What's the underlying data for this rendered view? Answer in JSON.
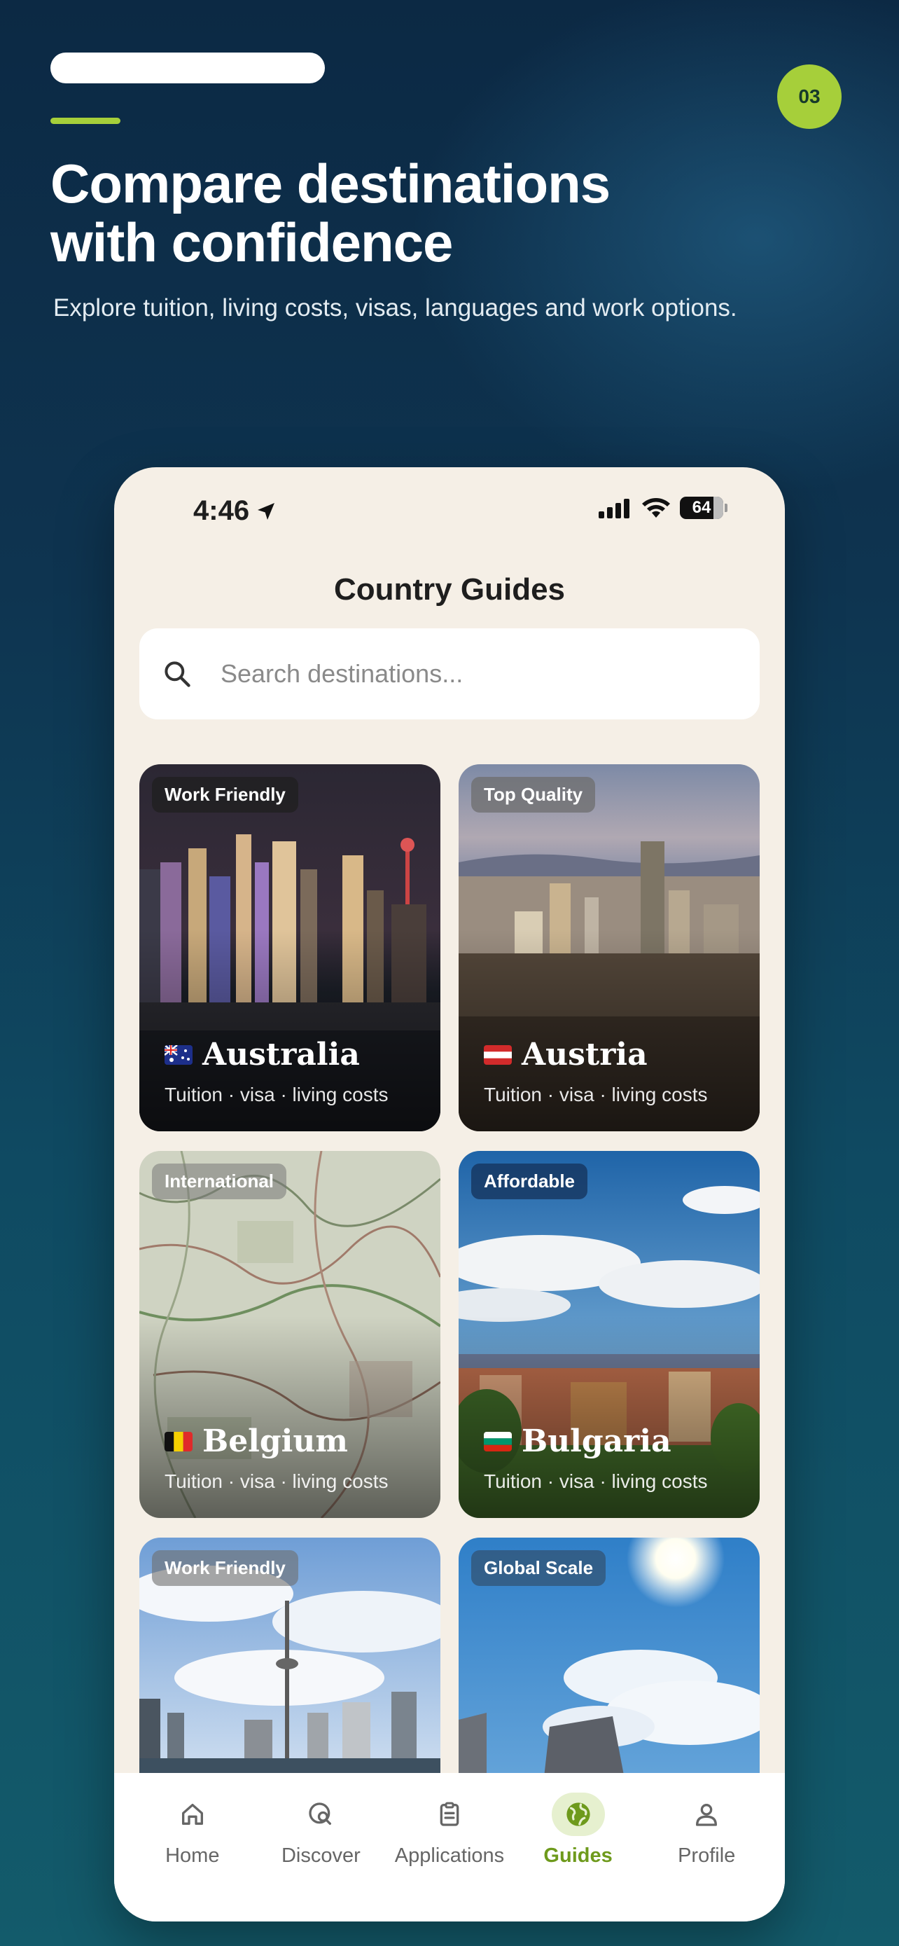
{
  "slide": {
    "step": "03",
    "headline_line1": "Compare destinations",
    "headline_line2": "with confidence",
    "subtitle": "Explore tuition, living costs, visas, languages and work options."
  },
  "status_bar": {
    "time": "4:46",
    "battery": "64"
  },
  "screen": {
    "title": "Country Guides",
    "search_placeholder": "Search destinations..."
  },
  "cards": [
    {
      "tag": "Work Friendly",
      "name": "Australia",
      "subtitle": "Tuition · visa · living costs"
    },
    {
      "tag": "Top Quality",
      "name": "Austria",
      "subtitle": "Tuition · visa · living costs"
    },
    {
      "tag": "International",
      "name": "Belgium",
      "subtitle": "Tuition · visa · living costs"
    },
    {
      "tag": "Affordable",
      "name": "Bulgaria",
      "subtitle": "Tuition · visa · living costs"
    },
    {
      "tag": "Work Friendly",
      "name": "",
      "subtitle": ""
    },
    {
      "tag": "Global Scale",
      "name": "",
      "subtitle": ""
    }
  ],
  "nav": [
    {
      "label": "Home",
      "icon": "home-icon"
    },
    {
      "label": "Discover",
      "icon": "discover-icon"
    },
    {
      "label": "Applications",
      "icon": "clipboard-icon"
    },
    {
      "label": "Guides",
      "icon": "globe-icon",
      "active": true
    },
    {
      "label": "Profile",
      "icon": "person-icon"
    }
  ],
  "colors": {
    "accent": "#a6cf3a",
    "active_nav": "#6e9a1c",
    "screen_bg": "#f5efe6"
  }
}
